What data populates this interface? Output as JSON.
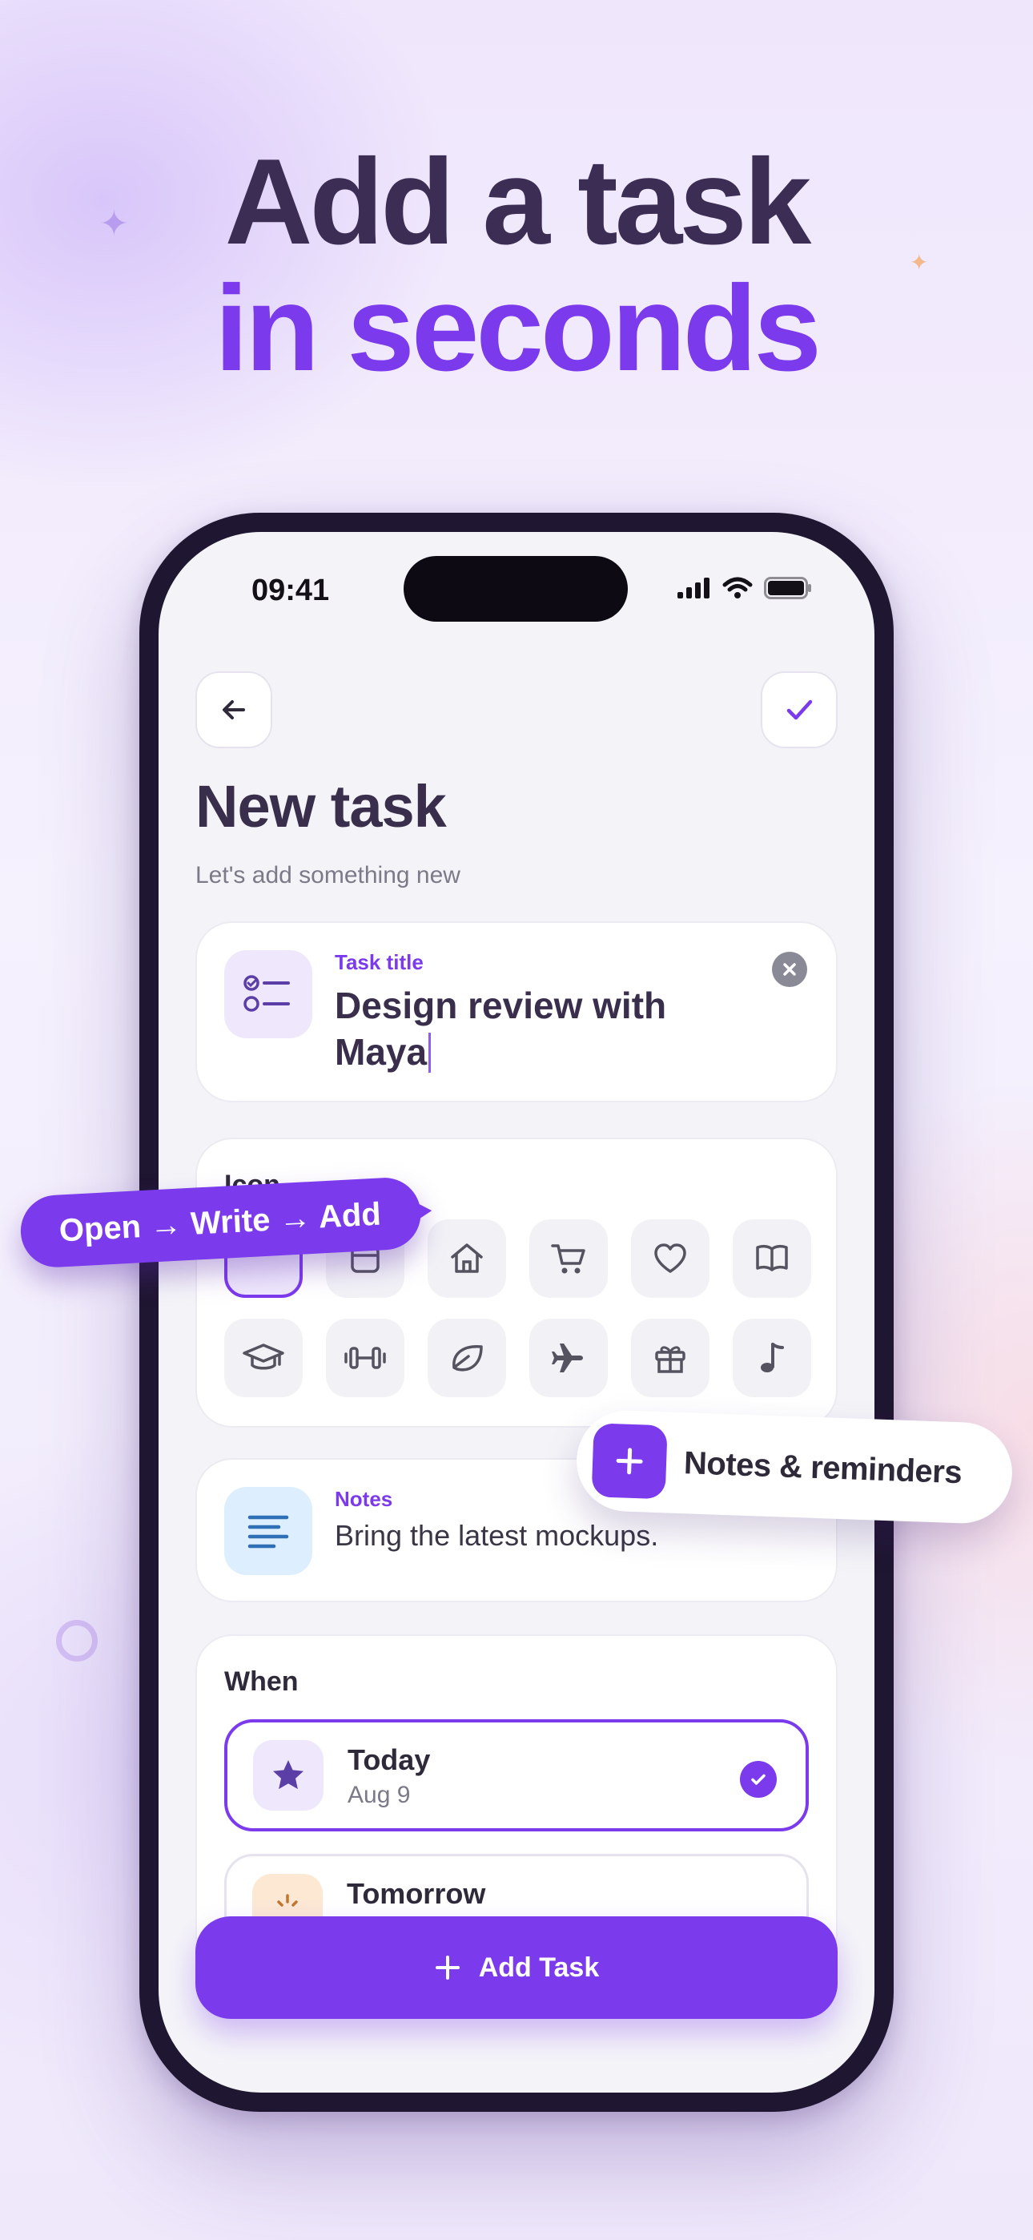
{
  "headline": {
    "line1": "Add a task",
    "line2": "in seconds"
  },
  "colors": {
    "accent": "#7c3aed",
    "dark_text": "#3a2e4d",
    "muted": "#7a7a88"
  },
  "status_bar": {
    "time": "09:41",
    "icons": [
      "signal-icon",
      "wifi-icon",
      "battery-icon"
    ]
  },
  "nav": {
    "back_icon": "arrow-left-icon",
    "confirm_icon": "checkmark-icon"
  },
  "page": {
    "title": "New task",
    "subtitle": "Let's add something new"
  },
  "task_title": {
    "label": "Task title",
    "value_line1": "Design review with",
    "value_line2": "Maya",
    "icon": "checklist-icon",
    "clear_icon": "clear-icon"
  },
  "icon_picker": {
    "label": "Icon",
    "icons": [
      "selected-icon",
      "calendar-icon",
      "home-icon",
      "cart-icon",
      "heart-icon",
      "book-icon",
      "graduation-cap-icon",
      "dumbbell-icon",
      "leaf-icon",
      "airplane-icon",
      "gift-icon",
      "music-note-icon"
    ]
  },
  "notes": {
    "label": "Notes",
    "value": "Bring the latest mockups.",
    "icon": "text-lines-icon"
  },
  "when": {
    "label": "When",
    "options": [
      {
        "title": "Today",
        "subtitle": "Aug 9",
        "icon": "star-icon",
        "selected": true
      },
      {
        "title": "Tomorrow",
        "subtitle": "",
        "icon": "sunrise-icon",
        "selected": false
      }
    ]
  },
  "add_button": {
    "label": "Add Task"
  },
  "callouts": {
    "flow": "Open → Write → Add",
    "feature": "Notes & reminders"
  }
}
